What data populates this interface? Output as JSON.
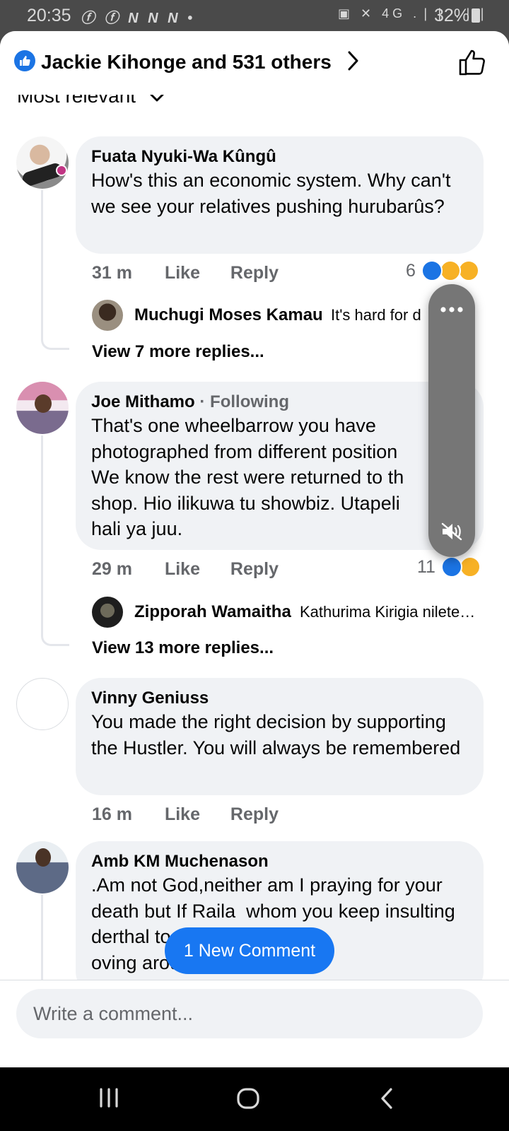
{
  "status_bar": {
    "time": "20:35",
    "left_icons": "ⓕ ⓕ N N N •",
    "right_icons": "▣ ✕ 4G .❘❘ .❘❘",
    "battery": "32%"
  },
  "header": {
    "title": "Jackie Kihonge and 531 others"
  },
  "sort": {
    "label": "Most relevant"
  },
  "comments": [
    {
      "author": "Fuata Nyuki-Wa Kûngû",
      "text": "How's this an economic system. Why can't we see your relatives pushing hurubarûs?",
      "time": "31 m",
      "like": "Like",
      "reply": "Reply",
      "reactions": "6",
      "reply_preview": {
        "name": "Muchugi Moses Kamau",
        "text": "It's hard for d"
      },
      "view_more": "View 7 more replies..."
    },
    {
      "author": "Joe Mithamo",
      "following": "Following",
      "text": "That's one wheelbarrow you have photographed from different position We know the rest were returned to th shop. Hio ilikuwa tu showbiz. Utapeli hali ya juu.",
      "time": "29 m",
      "like": "Like",
      "reply": "Reply",
      "reactions": "11",
      "reply_preview": {
        "name": "Zipporah Wamaitha",
        "text": "Kathurima Kirigia nilete…"
      },
      "view_more": "View 13 more replies..."
    },
    {
      "author": "Vinny Geniuss",
      "text": "You made the right decision by supporting the Hustler. You will always be remembered",
      "time": "16 m",
      "like": "Like",
      "reply": "Reply"
    },
    {
      "author": "Amb KM Muchenason",
      "text": ".Am not God,neither am I praying for your death but If Raila  whom you keep insulting                          derthal tool like that whe                          oving around"
    }
  ],
  "new_comment_pill": "1 New Comment",
  "composer": {
    "placeholder": "Write a comment..."
  },
  "colors": {
    "brand_blue": "#1877f2",
    "bubble_bg": "#f0f2f5",
    "secondary_text": "#65676b"
  },
  "icons": [
    "like-icon",
    "chevron-right-icon",
    "thumbs-up-outline-icon",
    "chevron-down-icon",
    "more-dots-icon",
    "mute-icon",
    "recents-icon",
    "home-icon",
    "back-icon"
  ]
}
